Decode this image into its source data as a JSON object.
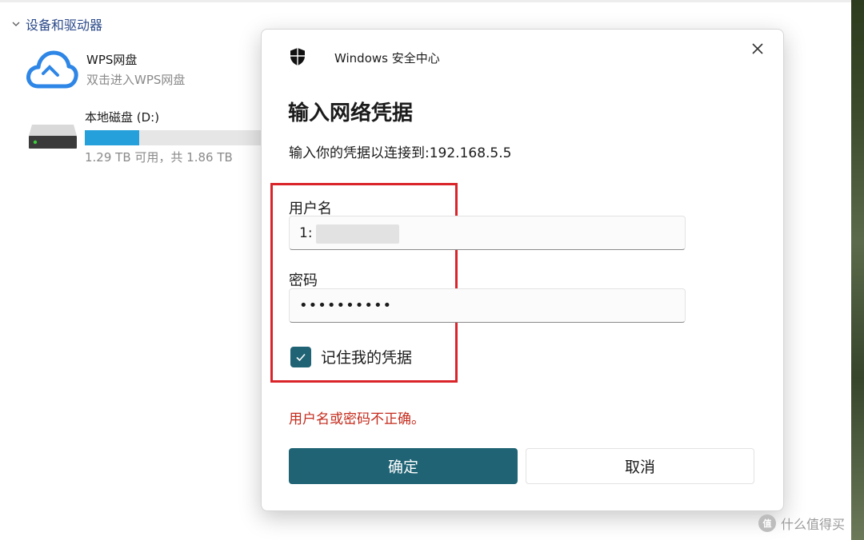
{
  "explorer": {
    "section_header": "设备和驱动器",
    "wps": {
      "name": "WPS网盘",
      "subtitle": "双击进入WPS网盘"
    },
    "disk": {
      "name": "本地磁盘 (D:)",
      "usage_text": "1.29 TB 可用，共 1.86 TB",
      "used_fraction": 0.31
    }
  },
  "dialog": {
    "app_title": "Windows 安全中心",
    "heading": "输入网络凭据",
    "subtitle": "输入你的凭据以连接到:192.168.5.5",
    "username_label": "用户名",
    "username_value": "1:",
    "password_label": "密码",
    "password_value": "••••••••••",
    "remember_label": "记住我的凭据",
    "remember_checked": true,
    "error_text": "用户名或密码不正确。",
    "ok_label": "确定",
    "cancel_label": "取消"
  },
  "watermark": {
    "logo_text": "值",
    "text": "什么值得买"
  },
  "colors": {
    "accent": "#1f6374",
    "error": "#c42b1c",
    "highlight_box": "#d9252a",
    "section_header": "#2b4a8a"
  },
  "icons": {
    "shield": "shield-icon",
    "close": "close-icon",
    "cloud": "cloud-icon",
    "disk": "hard-disk-icon",
    "check": "check-icon",
    "chevron": "chevron-down-icon"
  }
}
